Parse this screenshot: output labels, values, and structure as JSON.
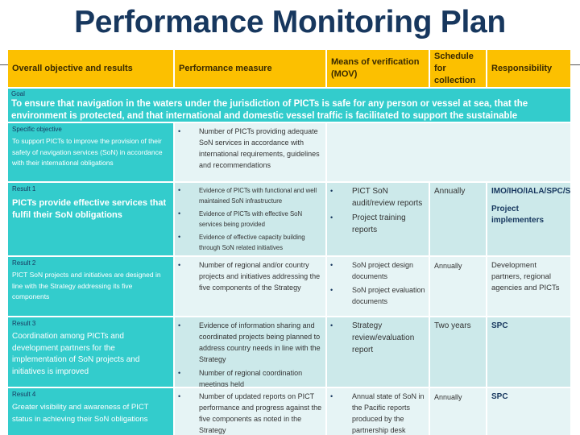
{
  "title": "Performance Monitoring Plan",
  "columns": {
    "objective": "Overall objective and results",
    "measure": "Performance measure",
    "mov": "Means of verification (MOV)",
    "schedule": "Schedule for collection",
    "responsibility": "Responsibility"
  },
  "goal": {
    "label": "Goal",
    "text": "To ensure that navigation in the waters under the jurisdiction of PICTs is safe for any person or vessel at sea, that the environment is protected, and that international and domestic vessel traffic is facilitated to support the sustainable development of PICTs"
  },
  "specific_objective": {
    "label": "Specific objective",
    "text": "To support PICTs to improve the provision of their safety of navigation services (SoN) in accordance with their international obligations",
    "measures": [
      "Number of PICTs providing adequate SoN services in accordance with international requirements, guidelines and recommendations"
    ]
  },
  "results": [
    {
      "label": "Result 1",
      "text": "PICTs provide effective services that fulfil their SoN obligations",
      "measures": [
        "Evidence of PICTs with functional and well maintained SoN infrastructure",
        "Evidence of PICTs with effective SoN services being provided",
        "Evidence of effective capacity building through SoN related initiatives"
      ],
      "mov": [
        "PICT SoN audit/review reports",
        "Project training reports"
      ],
      "schedule": "Annually",
      "responsibility": [
        "IMO/IHO/IALA/SPC/SPREP",
        "Project implementers"
      ]
    },
    {
      "label": "Result 2",
      "text": "PICT SoN projects and initiatives are designed in line with the Strategy addressing its five components",
      "measures": [
        "Number of regional and/or country projects and initiatives addressing the five components of the Strategy"
      ],
      "mov": [
        "SoN project design documents",
        "SoN project evaluation documents"
      ],
      "schedule": "Annually",
      "responsibility": [
        "Development partners, regional agencies and PICTs"
      ]
    },
    {
      "label": "Result 3",
      "text": "Coordination among PICTs and development partners for the implementation of SoN projects and initiatives is improved",
      "measures": [
        "Evidence of information sharing and coordinated projects being planned to address country needs in line with the Strategy",
        "Number of regional coordination meetings held"
      ],
      "mov": [
        "Strategy review/evaluation report"
      ],
      "schedule": "Two years",
      "responsibility": [
        "SPC"
      ]
    },
    {
      "label": "Result 4",
      "text": "Greater visibility and awareness of PICT status in achieving their SoN obligations",
      "measures": [
        "Number of updated reports on PICT performance and progress against the five components as noted in the Strategy"
      ],
      "mov": [
        "Annual state of SoN in the Pacific reports produced by the partnership desk"
      ],
      "schedule": "Annually",
      "responsibility": [
        "SPC"
      ]
    }
  ],
  "icons": {
    "bullet": "•"
  }
}
